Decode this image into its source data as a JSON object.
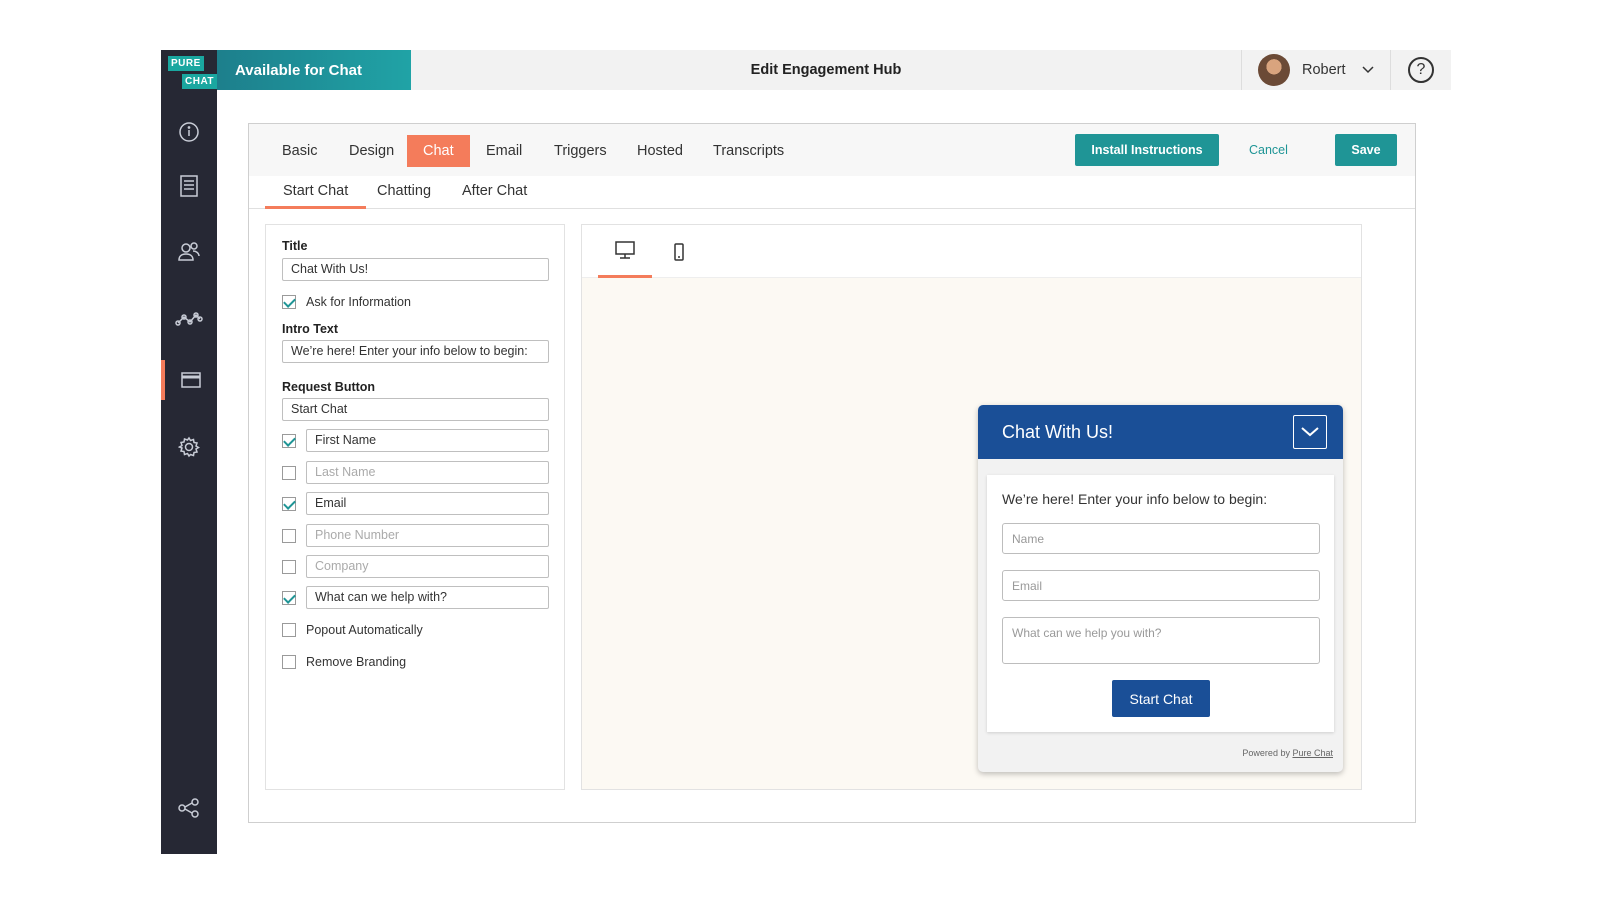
{
  "logo": {
    "line1": "PURE",
    "line2": "CHAT"
  },
  "sidebar": {
    "items": [
      {
        "icon": "info-icon"
      },
      {
        "icon": "document-icon"
      },
      {
        "icon": "users-icon"
      },
      {
        "icon": "analytics-icon"
      },
      {
        "icon": "widget-icon",
        "active": true
      },
      {
        "icon": "gear-icon"
      },
      {
        "icon": "share-icon"
      }
    ]
  },
  "topbar": {
    "status": "Available for Chat",
    "title": "Edit Engagement Hub",
    "user": "Robert",
    "help": "?"
  },
  "tabs": [
    "Basic",
    "Design",
    "Chat",
    "Email",
    "Triggers",
    "Hosted",
    "Transcripts"
  ],
  "active_tab": "Chat",
  "actions": {
    "install": "Install Instructions",
    "cancel": "Cancel",
    "save": "Save"
  },
  "subtabs": [
    "Start Chat",
    "Chatting",
    "After Chat"
  ],
  "active_subtab": "Start Chat",
  "form": {
    "title_label": "Title",
    "title_value": "Chat With Us!",
    "ask_info": "Ask for Information",
    "intro_label": "Intro Text",
    "intro_value": "We’re here! Enter your info below to begin:",
    "request_label": "Request Button",
    "request_value": "Start Chat",
    "fields": [
      {
        "label": "First Name",
        "checked": true
      },
      {
        "label": "Last Name",
        "checked": false
      },
      {
        "label": "Email",
        "checked": true
      },
      {
        "label": "Phone Number",
        "checked": false
      },
      {
        "label": "Company",
        "checked": false
      },
      {
        "label": "What can we help with?",
        "checked": true
      }
    ],
    "popout": "Popout Automatically",
    "branding": "Remove Branding"
  },
  "widget": {
    "title": "Chat With Us!",
    "intro": "We’re here! Enter your info below to begin:",
    "name_ph": "Name",
    "email_ph": "Email",
    "help_ph": "What can we help you with?",
    "button": "Start Chat",
    "powered_by": "Powered by",
    "powered_link": "Pure Chat"
  },
  "colors": {
    "accent": "#f47c5b",
    "teal": "#1f9596",
    "brand_blue": "#1a4f97",
    "sidebar": "#262834"
  }
}
